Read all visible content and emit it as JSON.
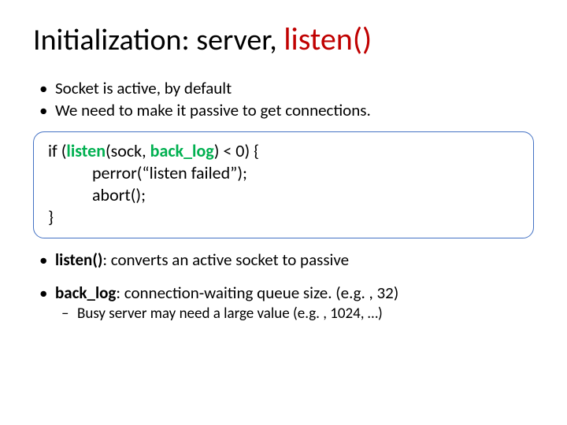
{
  "title": {
    "prefix": "Initialization: server, ",
    "fn": "listen()"
  },
  "bullets_top": [
    "Socket is active, by default",
    "We need to make it passive to get connections."
  ],
  "code": {
    "l1a": "if (",
    "l1_listen": "listen",
    "l1b": "(sock, ",
    "l1_backlog": "back_log",
    "l1c": ") < 0) {",
    "l2": "perror(“listen failed”);",
    "l3": "abort();",
    "l4": "}"
  },
  "bullets_bottom": [
    {
      "bold": "listen()",
      "rest": ": converts an active socket to passive",
      "sub": []
    },
    {
      "bold": "back_log",
      "rest": ": connection-waiting queue size. (e.g. , 32)",
      "sub": [
        "Busy server may need a large value (e.g. , 1024, …)"
      ]
    }
  ]
}
